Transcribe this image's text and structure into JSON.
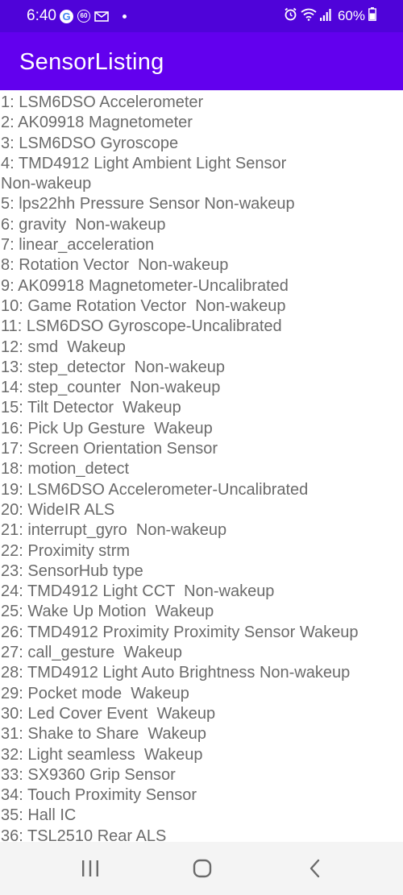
{
  "status_bar": {
    "time": "6:40",
    "battery": "60%",
    "icons_left": [
      "google-icon",
      "sixty-badge-icon",
      "mail-icon",
      "notification-dot-icon"
    ],
    "icons_right": [
      "alarm-icon",
      "wifi-icon",
      "signal-icon",
      "battery-icon"
    ],
    "google_letter": "G",
    "badge_text": "60"
  },
  "app_bar": {
    "title": "SensorListing",
    "color": "#6200ee"
  },
  "colors": {
    "status_bar": "#4f03d9",
    "list_text": "#6b6b6b",
    "nav_bar": "#f4f4f4"
  },
  "sensors": [
    "1: LSM6DSO Accelerometer",
    "2: AK09918 Magnetometer",
    "3: LSM6DSO Gyroscope",
    "4: TMD4912 Light Ambient Light Sensor\nNon-wakeup",
    "5: lps22hh Pressure Sensor Non-wakeup",
    "6: gravity  Non-wakeup",
    "7: linear_acceleration",
    "8: Rotation Vector  Non-wakeup",
    "9: AK09918 Magnetometer-Uncalibrated",
    "10: Game Rotation Vector  Non-wakeup",
    "11: LSM6DSO Gyroscope-Uncalibrated",
    "12: smd  Wakeup",
    "13: step_detector  Non-wakeup",
    "14: step_counter  Non-wakeup",
    "15: Tilt Detector  Wakeup",
    "16: Pick Up Gesture  Wakeup",
    "17: Screen Orientation Sensor",
    "18: motion_detect",
    "19: LSM6DSO Accelerometer-Uncalibrated",
    "20: WideIR ALS",
    "21: interrupt_gyro  Non-wakeup",
    "22: Proximity strm",
    "23: SensorHub type",
    "24: TMD4912 Light CCT  Non-wakeup",
    "25: Wake Up Motion  Wakeup",
    "26: TMD4912 Proximity Proximity Sensor Wakeup",
    "27: call_gesture  Wakeup",
    "28: TMD4912 Light Auto Brightness Non-wakeup",
    "29: Pocket mode  Wakeup",
    "30: Led Cover Event  Wakeup",
    "31: Shake to Share  Wakeup",
    "32: Light seamless  Wakeup",
    "33: SX9360 Grip Sensor",
    "34: Touch Proximity Sensor",
    "35: Hall IC",
    "36: TSL2510 Rear ALS"
  ],
  "nav_bar": {
    "buttons": [
      "recent-apps-icon",
      "home-icon",
      "back-icon"
    ]
  }
}
